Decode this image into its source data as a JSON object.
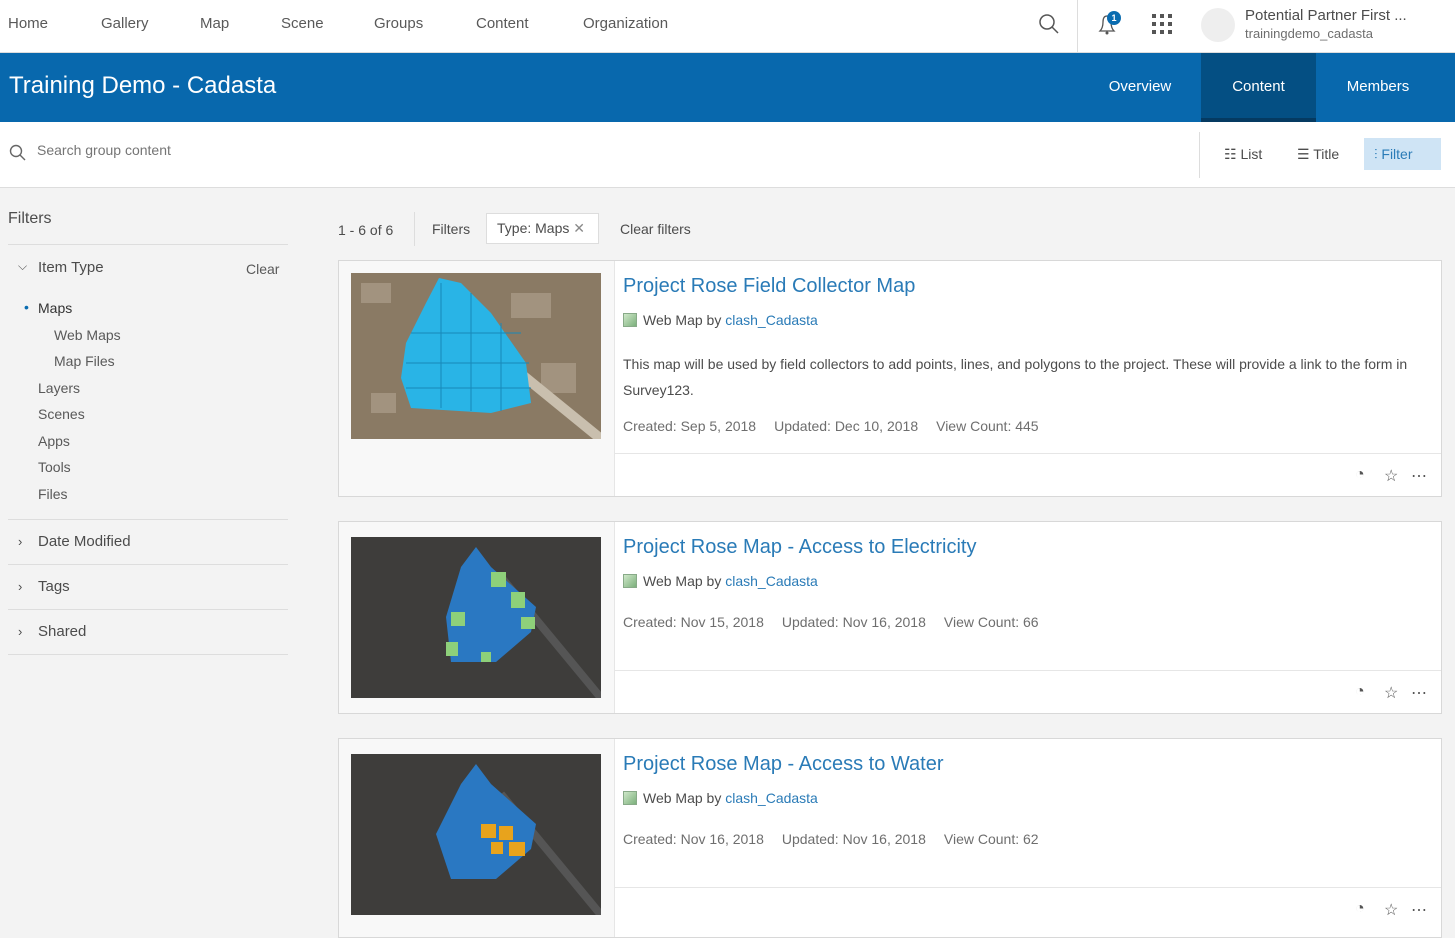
{
  "topnav": {
    "items": [
      "Home",
      "Gallery",
      "Map",
      "Scene",
      "Groups",
      "Content",
      "Organization"
    ],
    "notification_count": "1",
    "user_name": "Potential Partner First ...",
    "username": "trainingdemo_cadasta"
  },
  "banner": {
    "title": "Training Demo - Cadasta",
    "tabs": [
      "Overview",
      "Content",
      "Members"
    ],
    "active_tab": "Content"
  },
  "search": {
    "placeholder": "Search group content",
    "views": [
      "List",
      "Title",
      "Filter"
    ]
  },
  "filters": {
    "heading": "Filters",
    "item_type": "Item Type",
    "clear": "Clear",
    "types": [
      "Maps",
      "Web Maps",
      "Map Files",
      "Layers",
      "Scenes",
      "Apps",
      "Tools",
      "Files"
    ],
    "sections": [
      "Date Modified",
      "Tags",
      "Shared"
    ]
  },
  "results": {
    "count": "1 - 6 of 6",
    "filters_label": "Filters",
    "chip": "Type: Maps",
    "clear_filters": "Clear filters"
  },
  "items": [
    {
      "title": "Project Rose Field Collector Map",
      "type": "Web Map by",
      "owner": "clash_Cadasta",
      "description": "This map will be used by field collectors to add points, lines, and polygons to the project. These will provide a link to the form in Survey123.",
      "created": "Created: Sep 5, 2018",
      "updated": "Updated: Dec 10, 2018",
      "views": "View Count: 445"
    },
    {
      "title": "Project Rose Map - Access to Electricity",
      "type": "Web Map by",
      "owner": "clash_Cadasta",
      "created": "Created: Nov 15, 2018",
      "updated": "Updated: Nov 16, 2018",
      "views": "View Count: 66"
    },
    {
      "title": "Project Rose Map - Access to Water",
      "type": "Web Map by",
      "owner": "clash_Cadasta",
      "created": "Created: Nov 16, 2018",
      "updated": "Updated: Nov 16, 2018",
      "views": "View Count: 62"
    }
  ],
  "colors": {
    "brand": "#0868ad",
    "link": "#2a7bb7"
  }
}
